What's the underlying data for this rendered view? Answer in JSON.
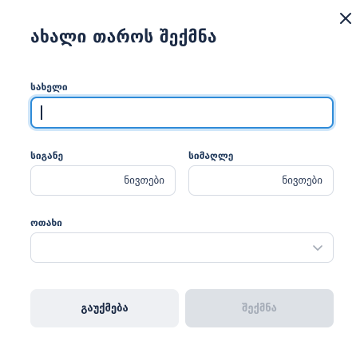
{
  "dialog": {
    "title": "ახალი თაროს შექმნა",
    "close_icon": "close-icon"
  },
  "form": {
    "name": {
      "label": "სახელი",
      "value": ""
    },
    "width": {
      "label": "სიგანე",
      "value": "",
      "unit": "ნივთები"
    },
    "height": {
      "label": "სიმაღლე",
      "value": "",
      "unit": "ნივთები"
    },
    "room": {
      "label": "ოთახი",
      "selected": "",
      "icon": "chevron-down-icon"
    }
  },
  "actions": {
    "cancel_label": "გაუქმება",
    "create_label": "შექმნა"
  }
}
